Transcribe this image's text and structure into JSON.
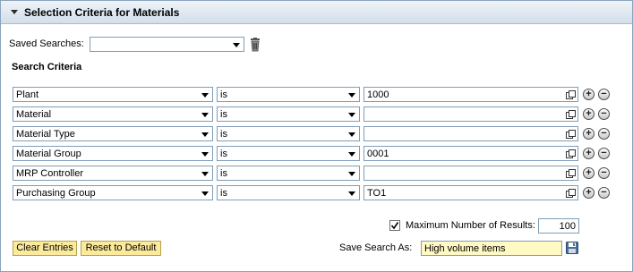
{
  "panel": {
    "title": "Selection Criteria for Materials"
  },
  "saved_searches": {
    "label": "Saved Searches:",
    "value": ""
  },
  "criteria": {
    "title": "Search Criteria",
    "rows": [
      {
        "field": "Plant",
        "operator": "is",
        "value": "1000"
      },
      {
        "field": "Material",
        "operator": "is",
        "value": ""
      },
      {
        "field": "Material Type",
        "operator": "is",
        "value": ""
      },
      {
        "field": "Material Group",
        "operator": "is",
        "value": "0001"
      },
      {
        "field": "MRP Controller",
        "operator": "is",
        "value": ""
      },
      {
        "field": "Purchasing Group",
        "operator": "is",
        "value": "TO1"
      }
    ]
  },
  "add_symbol": "+",
  "remove_symbol": "−",
  "max_results": {
    "label": "Maximum Number of Results:",
    "checked": true,
    "value": "100"
  },
  "buttons": {
    "clear": "Clear Entries",
    "reset": "Reset to Default"
  },
  "save_search": {
    "label": "Save Search As:",
    "value": "High volume items"
  },
  "colors": {
    "header_bg": "#d3dfeb",
    "button_bg": "#fbea9c",
    "save_input_bg": "#fff9c4",
    "input_border": "#7f9db9"
  },
  "icons": [
    "collapse-triangle-icon",
    "trash-icon",
    "value-help-icon",
    "add-icon",
    "remove-icon",
    "checkbox-check-icon",
    "save-disk-icon"
  ]
}
